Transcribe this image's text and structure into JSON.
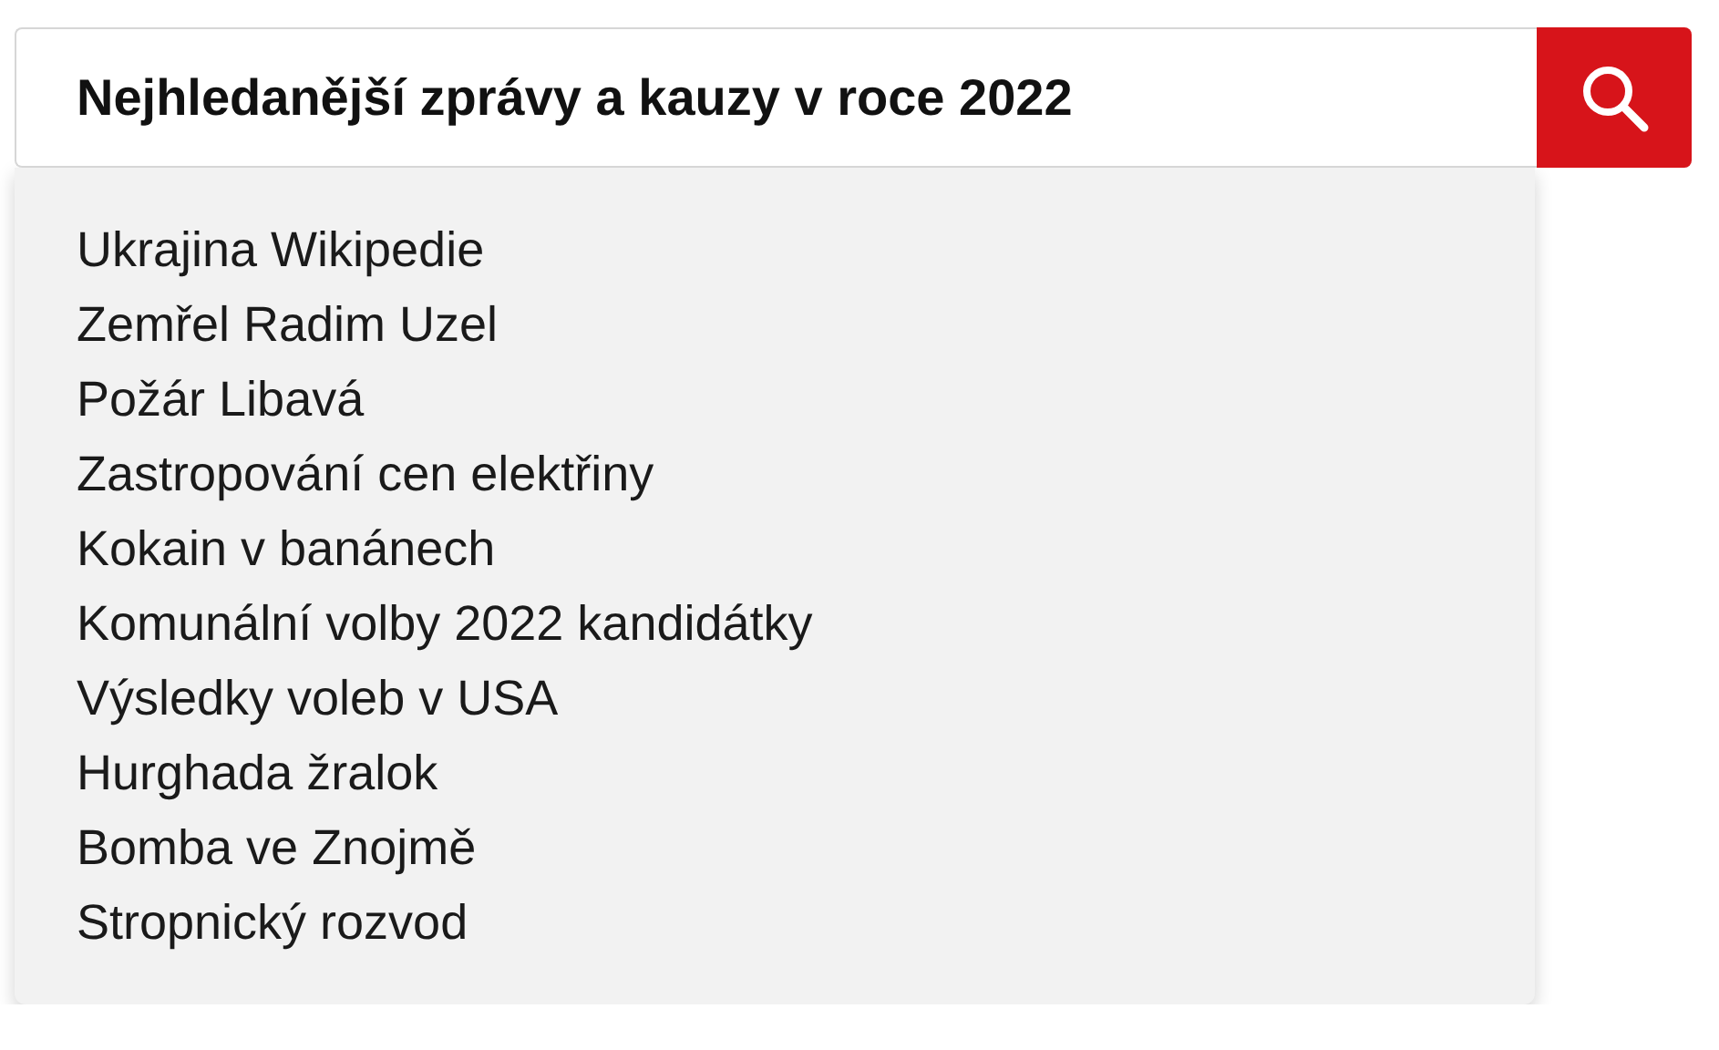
{
  "search": {
    "value": "Nejhledanější zprávy a kauzy v roce 2022"
  },
  "suggestions": [
    "Ukrajina Wikipedie",
    "Zemřel Radim Uzel",
    "Požár Libavá",
    "Zastropování cen elektřiny",
    "Kokain v banánech",
    "Komunální volby 2022 kandidátky",
    "Výsledky voleb v USA",
    "Hurghada žralok",
    "Bomba ve Znojmě",
    "Stropnický rozvod"
  ]
}
